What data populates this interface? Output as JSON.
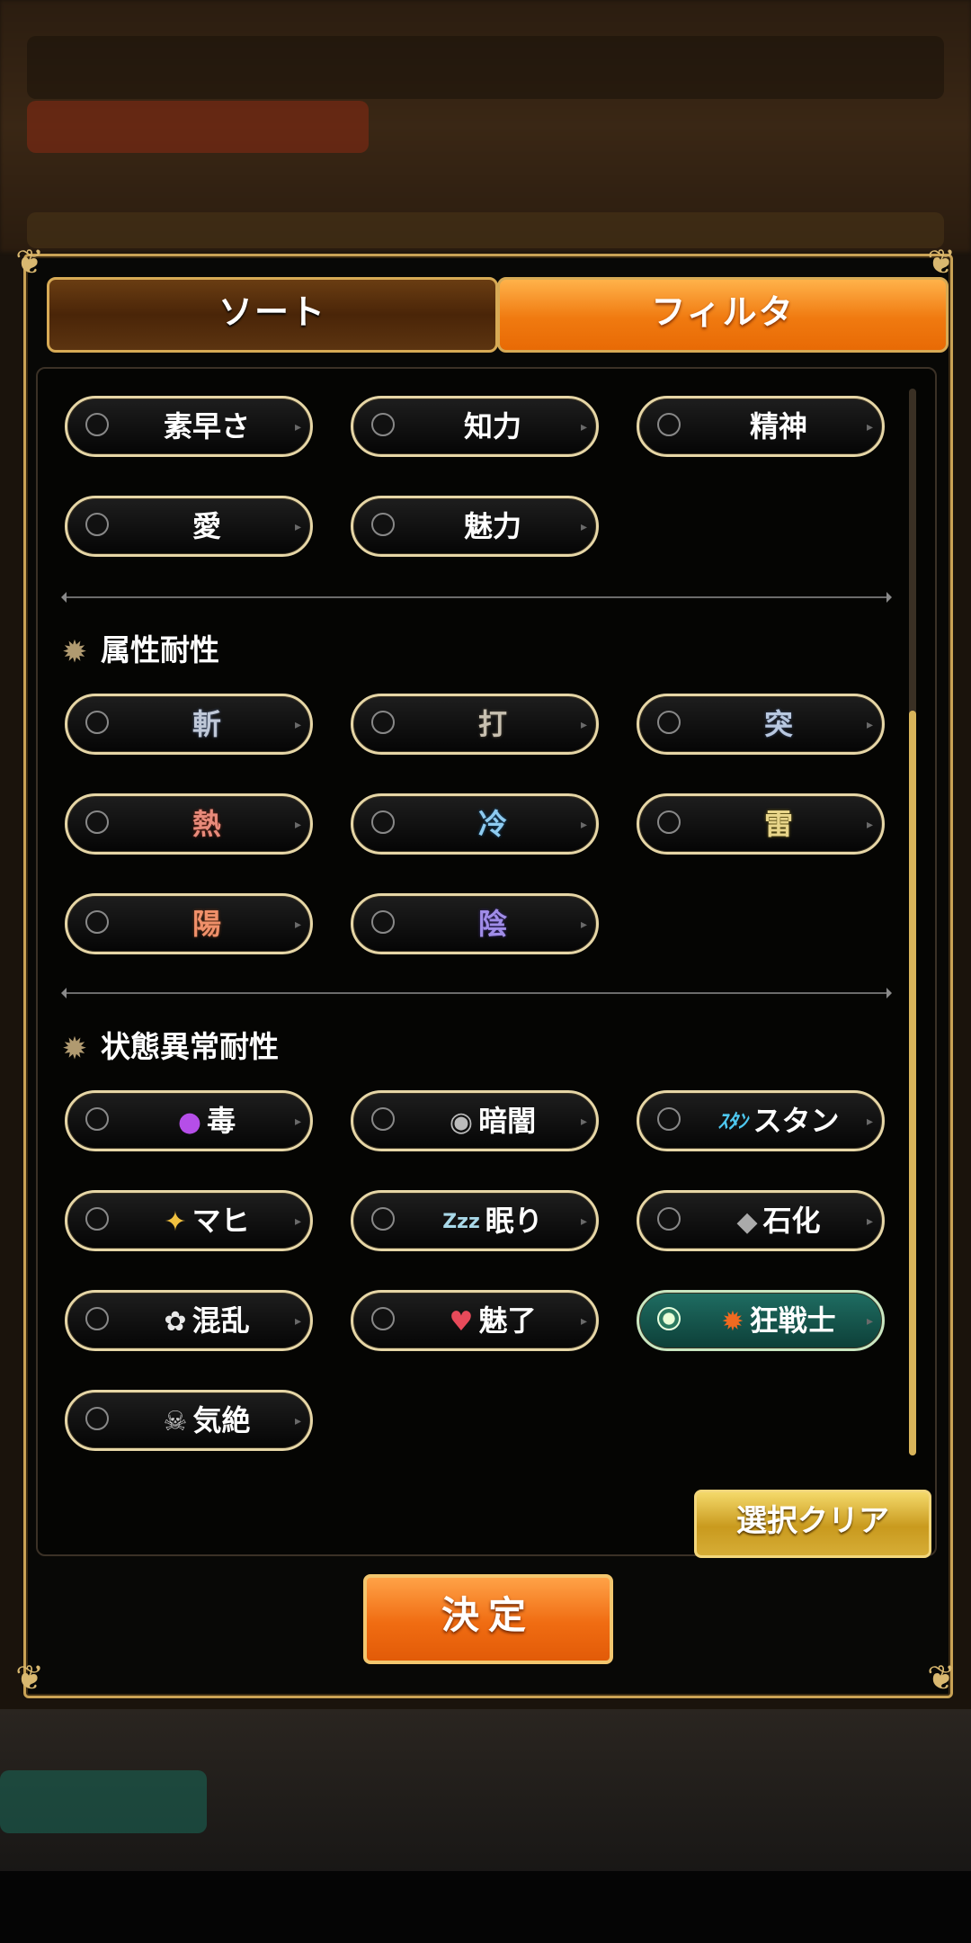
{
  "tabs": {
    "sort_label": "ソート",
    "filter_label": "フィルタ"
  },
  "stat_filters": [
    {
      "label": "素早さ"
    },
    {
      "label": "知力"
    },
    {
      "label": "精神"
    },
    {
      "label": "愛"
    },
    {
      "label": "魅力"
    }
  ],
  "element_section": {
    "title": "属性耐性",
    "items": [
      {
        "glyph": "斬",
        "color": "#bfc8d8"
      },
      {
        "glyph": "打",
        "color": "#c8c0b0"
      },
      {
        "glyph": "突",
        "color": "#b8c8e0"
      },
      {
        "glyph": "熱",
        "color": "#e88a7a"
      },
      {
        "glyph": "冷",
        "color": "#8ecbf0"
      },
      {
        "glyph": "雷",
        "color": "#e8d58a"
      },
      {
        "glyph": "陽",
        "color": "#f0906a"
      },
      {
        "glyph": "陰",
        "color": "#a08ce8"
      }
    ]
  },
  "status_section": {
    "title": "状態異常耐性",
    "items": [
      {
        "label": "毒",
        "icon": "poison-icon",
        "glyph": "●",
        "color": "#b54ee8"
      },
      {
        "label": "暗闇",
        "icon": "eye-icon",
        "glyph": "◉",
        "color": "#bbbbbb"
      },
      {
        "label": "スタン",
        "icon": "stun-icon",
        "glyph": "ｽﾀﾝ",
        "color": "#4ec8f0"
      },
      {
        "label": "マヒ",
        "icon": "paralysis-icon",
        "glyph": "✦",
        "color": "#f0c040"
      },
      {
        "label": "眠り",
        "icon": "sleep-icon",
        "glyph": "Zzz",
        "color": "#a8d8e8"
      },
      {
        "label": "石化",
        "icon": "stone-icon",
        "glyph": "◆",
        "color": "#aaaaaa"
      },
      {
        "label": "混乱",
        "icon": "confusion-icon",
        "glyph": "✿",
        "color": "#e8e8e8"
      },
      {
        "label": "魅了",
        "icon": "charm-icon",
        "glyph": "♥",
        "color": "#e84a5a"
      },
      {
        "label": "狂戦士",
        "icon": "berserk-icon",
        "glyph": "✹",
        "color": "#f06a20",
        "selected": true
      },
      {
        "label": "気絶",
        "icon": "faint-icon",
        "glyph": "☠",
        "color": "#cccccc"
      }
    ]
  },
  "buttons": {
    "clear_label": "選択クリア",
    "ok_label": "決定"
  },
  "colors": {
    "accent_orange": "#f07a10",
    "gold_border": "#d7aa55",
    "selected_teal": "#1f6d62"
  }
}
